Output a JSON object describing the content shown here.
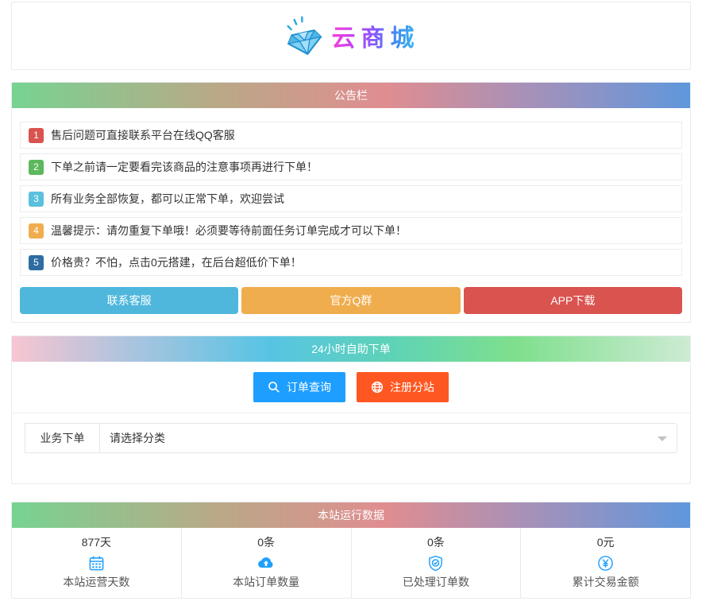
{
  "logo": {
    "title": "云商城",
    "icon": "diamond-icon"
  },
  "notice": {
    "header": "公告栏",
    "items": [
      {
        "num": "1",
        "color": "#d9534f",
        "text": "售后问题可直接联系平台在线QQ客服"
      },
      {
        "num": "2",
        "color": "#5cb85c",
        "text": "下单之前请一定要看完该商品的注意事项再进行下单！"
      },
      {
        "num": "3",
        "color": "#5bc0de",
        "text": "所有业务全部恢复，都可以正常下单，欢迎尝试"
      },
      {
        "num": "4",
        "color": "#f0ad4e",
        "text": "温馨提示：请勿重复下单哦！必须要等待前面任务订单完成才可以下单！"
      },
      {
        "num": "5",
        "color": "#2e6da4",
        "text": "价格贵？不怕，点击0元搭建，在后台超低价下单！"
      }
    ],
    "buttons": [
      {
        "label": "联系客服",
        "color": "#4fb7dc"
      },
      {
        "label": "官方Q群",
        "color": "#f0ad4e"
      },
      {
        "label": "APP下载",
        "color": "#d9534f"
      }
    ]
  },
  "order": {
    "header": "24小时自助下单",
    "buttons": [
      {
        "label": "订单查询",
        "icon": "search-icon",
        "color": "#1E9FFF"
      },
      {
        "label": "注册分站",
        "icon": "globe-icon",
        "color": "#FF5722"
      }
    ],
    "form": {
      "label": "业务下单",
      "select_value": "请选择分类"
    }
  },
  "stats": {
    "header": "本站运行数据",
    "items": [
      {
        "value": "877天",
        "icon": "calendar-icon",
        "label": "本站运营天数"
      },
      {
        "value": "0条",
        "icon": "cloud-upload-icon",
        "label": "本站订单数量"
      },
      {
        "value": "0条",
        "icon": "shield-check-icon",
        "label": "已处理订单数"
      },
      {
        "value": "0元",
        "icon": "yen-circle-icon",
        "label": "累计交易金额"
      }
    ]
  },
  "colors": {
    "accent_blue": "#1E9FFF",
    "accent_orange": "#FF5722",
    "header_gradient_rainbow": [
      "#77d392",
      "#e08d90",
      "#5f97dc"
    ],
    "header_gradient_cool": [
      "#f8c5d1",
      "#57c4e4",
      "#7edf8d"
    ]
  }
}
